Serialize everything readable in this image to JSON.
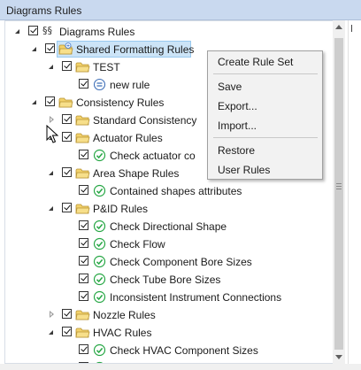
{
  "window": {
    "title": "Diagrams Rules"
  },
  "tree": {
    "root": {
      "label": "Diagrams Rules",
      "icon": "rules-root-icon"
    },
    "shared": {
      "label": "Shared Formatting Rules"
    },
    "test": {
      "label": "TEST"
    },
    "newrule": {
      "label": "new rule"
    },
    "consistency": {
      "label": "Consistency Rules"
    },
    "standard": {
      "label": "Standard Consistency"
    },
    "actuator": {
      "label": "Actuator Rules"
    },
    "check_actuator": {
      "label": "Check actuator co"
    },
    "area": {
      "label": "Area Shape Rules"
    },
    "contained": {
      "label": "Contained shapes attributes"
    },
    "pid": {
      "label": "P&ID Rules"
    },
    "directional": {
      "label": "Check Directional Shape"
    },
    "flow": {
      "label": "Check Flow"
    },
    "component_bore": {
      "label": "Check Component Bore Sizes"
    },
    "tube_bore": {
      "label": "Check Tube Bore Sizes"
    },
    "inconsistent": {
      "label": "Inconsistent Instrument Connections"
    },
    "nozzle": {
      "label": "Nozzle Rules"
    },
    "hvac": {
      "label": "HVAC Rules"
    },
    "hvac_sizes": {
      "label": "Check HVAC Component Sizes"
    }
  },
  "context_menu": {
    "create_rule_set": "Create Rule Set",
    "save": "Save",
    "export": "Export...",
    "import": "Import...",
    "restore": "Restore",
    "user_rules": "User Rules"
  },
  "colors": {
    "titlebar": "#c9d9ef",
    "selection": "#cce4f7",
    "folder": "#f3d26b",
    "rule_check": "#27a745"
  }
}
